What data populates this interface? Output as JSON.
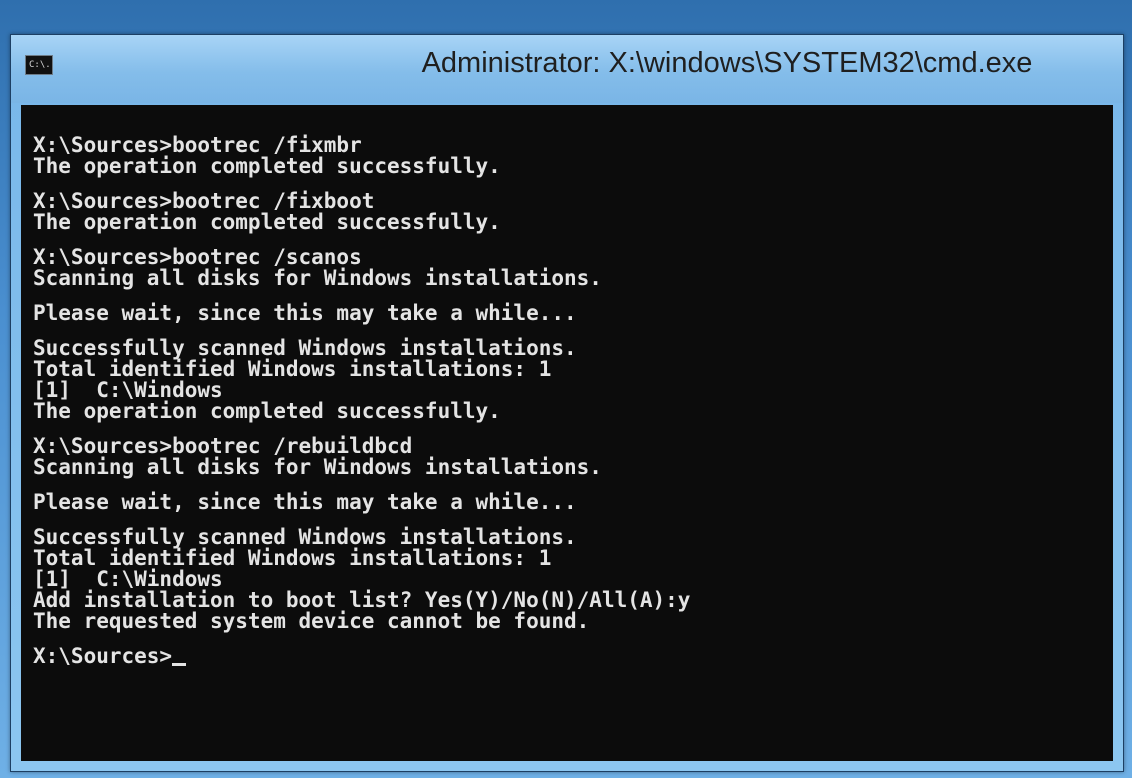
{
  "window": {
    "title": "Administrator: X:\\windows\\SYSTEM32\\cmd.exe",
    "icon_text": "C:\\."
  },
  "console": {
    "blocks": [
      [
        "X:\\Sources>bootrec /fixmbr",
        "The operation completed successfully."
      ],
      [
        "X:\\Sources>bootrec /fixboot",
        "The operation completed successfully."
      ],
      [
        "X:\\Sources>bootrec /scanos",
        "Scanning all disks for Windows installations."
      ],
      [
        "Please wait, since this may take a while..."
      ],
      [
        "Successfully scanned Windows installations.",
        "Total identified Windows installations: 1",
        "[1]  C:\\Windows",
        "The operation completed successfully."
      ],
      [
        "X:\\Sources>bootrec /rebuildbcd",
        "Scanning all disks for Windows installations."
      ],
      [
        "Please wait, since this may take a while..."
      ],
      [
        "Successfully scanned Windows installations.",
        "Total identified Windows installations: 1",
        "[1]  C:\\Windows",
        "Add installation to boot list? Yes(Y)/No(N)/All(A):y",
        "The requested system device cannot be found."
      ]
    ],
    "prompt": "X:\\Sources>"
  },
  "colors": {
    "console_bg": "#0c0c0c",
    "console_text": "#e4e4e4",
    "titlebar": "#84bdea"
  }
}
